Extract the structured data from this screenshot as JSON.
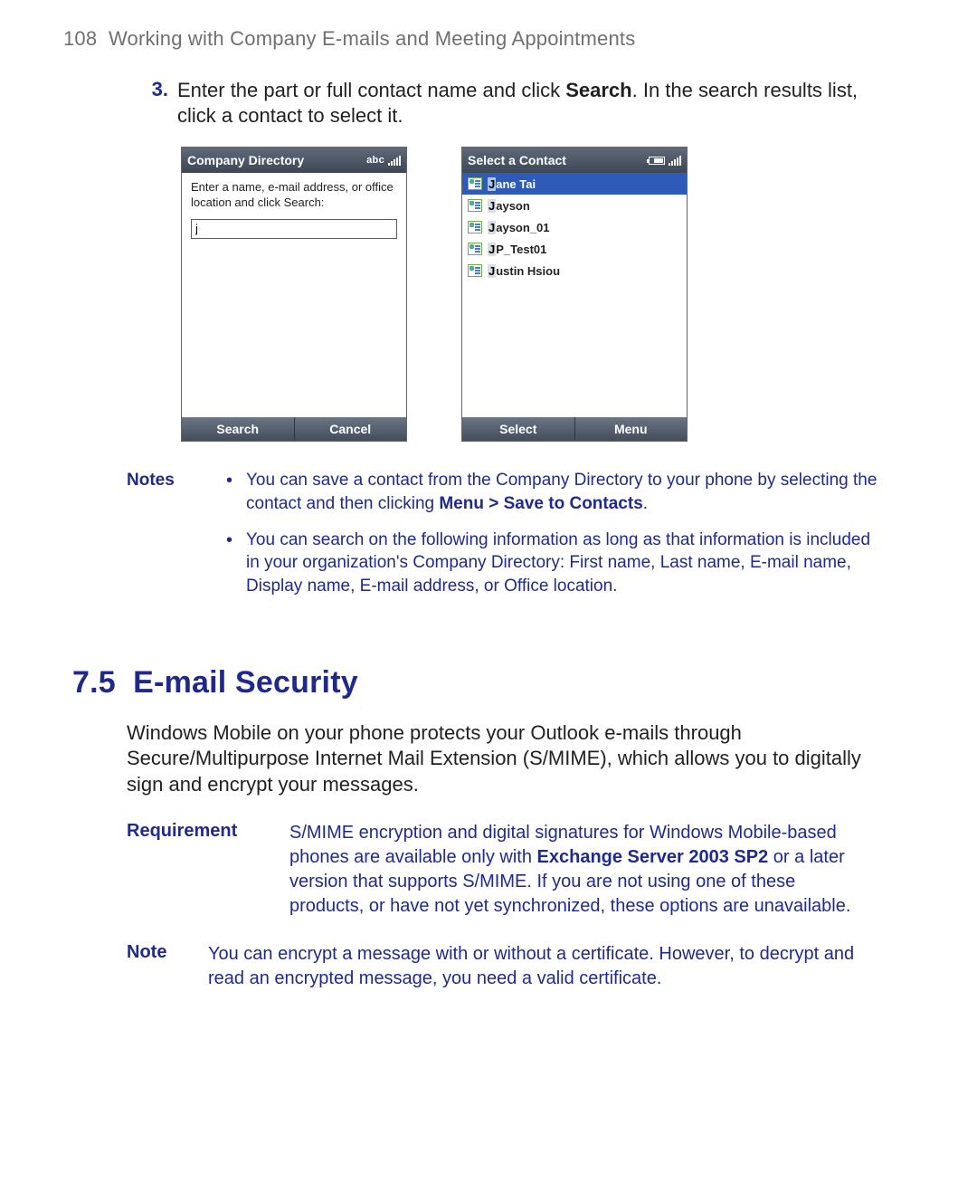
{
  "page_number": "108",
  "running_head_title": "Working with Company E-mails and Meeting Appointments",
  "step": {
    "marker": "3.",
    "text_before_bold": "Enter the part or full contact name and click ",
    "bold": "Search",
    "text_after_bold": ". In the search results list, click a contact to select it."
  },
  "screenshot_left": {
    "title": "Company Directory",
    "sys_abc": "abc",
    "hint": "Enter a name, e-mail address, or office location and click Search:",
    "input_value": "j",
    "softkey_left": "Search",
    "softkey_right": "Cancel"
  },
  "screenshot_right": {
    "title": "Select a Contact",
    "contacts": [
      {
        "hl": "J",
        "rest": "ane Tai",
        "selected": true
      },
      {
        "hl": "J",
        "rest": "ayson",
        "selected": false
      },
      {
        "hl": "J",
        "rest": "ayson_01",
        "selected": false
      },
      {
        "hl": "J",
        "rest": "P_Test01",
        "selected": false
      },
      {
        "hl": "J",
        "rest": "ustin Hsiou",
        "selected": false
      }
    ],
    "softkey_left": "Select",
    "softkey_right": "Menu"
  },
  "notes_label": "Notes",
  "notes": [
    {
      "pre": "You can save a contact from the Company Directory to your phone by selecting the contact and then clicking ",
      "bold": "Menu > Save to Contacts",
      "post": "."
    },
    {
      "pre": "You can search on the following information as long as that information is included in your organization's Company Directory: First name, Last name, E-mail name, Display name, E-mail address, or Office location.",
      "bold": "",
      "post": ""
    }
  ],
  "section": {
    "number": "7.5",
    "title": "E-mail Security"
  },
  "intro_paragraph": "Windows Mobile on your phone protects your Outlook e-mails through Secure/Multipurpose Internet Mail Extension (S/MIME), which allows you to digitally sign and encrypt your messages.",
  "requirement": {
    "label": "Requirement",
    "pre": "S/MIME encryption and digital signatures for Windows Mobile-based phones are available only with ",
    "bold": "Exchange Server 2003 SP2",
    "post": " or a later version that supports S/MIME. If you are not using one of these products, or have not yet synchronized, these options are unavailable."
  },
  "note2": {
    "label": "Note",
    "text": "You can encrypt a message with or without a certificate. However, to decrypt and read an encrypted message, you need a valid certificate."
  }
}
